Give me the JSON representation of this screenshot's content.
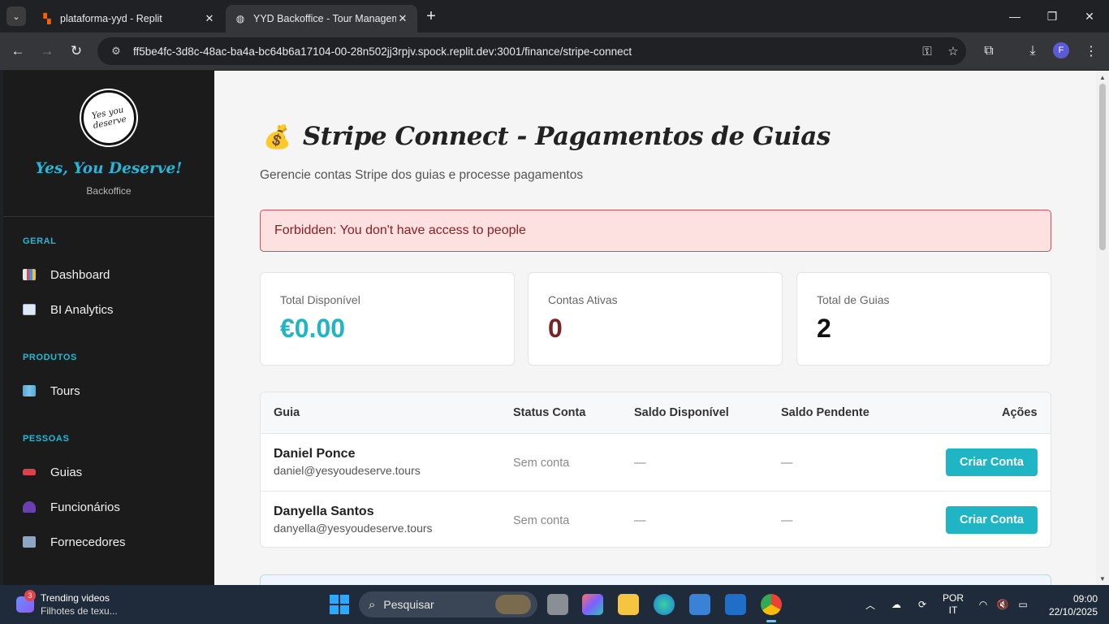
{
  "browser": {
    "tabs": [
      {
        "title": "plataforma-yyd - Replit",
        "active": false
      },
      {
        "title": "YYD Backoffice - Tour Management",
        "active": true
      }
    ],
    "url": "ff5be4fc-3d8c-48ac-ba4a-bc64b6a17104-00-28n502jj3rpjv.spock.replit.dev:3001/finance/stripe-connect",
    "profile_initial": "F"
  },
  "sidebar": {
    "logo_text": "Yes you deserve",
    "brand_name": "Yes, You Deserve!",
    "brand_sub": "Backoffice",
    "sections": [
      {
        "title": "GERAL",
        "items": [
          {
            "label": "Dashboard",
            "icon": "bar-chart-icon"
          },
          {
            "label": "BI Analytics",
            "icon": "line-chart-icon"
          }
        ]
      },
      {
        "title": "PRODUTOS",
        "items": [
          {
            "label": "Tours",
            "icon": "map-icon"
          }
        ]
      },
      {
        "title": "PESSOAS",
        "items": [
          {
            "label": "Guias",
            "icon": "car-icon"
          },
          {
            "label": "Funcionários",
            "icon": "person-icon"
          },
          {
            "label": "Fornecedores",
            "icon": "building-icon"
          }
        ]
      }
    ]
  },
  "page": {
    "title_emoji": "💰",
    "title": "Stripe Connect - Pagamentos de Guias",
    "subtitle": "Gerencie contas Stripe dos guias e processe pagamentos",
    "alert": "Forbidden: You don't have access to people",
    "stats": [
      {
        "label": "Total Disponível",
        "value": "€0.00",
        "color": "#1fb5c4"
      },
      {
        "label": "Contas Ativas",
        "value": "0",
        "color": "#7a2326"
      },
      {
        "label": "Total de Guias",
        "value": "2",
        "color": "#111111"
      }
    ],
    "table": {
      "headers": [
        "Guia",
        "Status Conta",
        "Saldo Disponível",
        "Saldo Pendente",
        "Ações"
      ],
      "rows": [
        {
          "name": "Daniel Ponce",
          "email": "daniel@yesyoudeserve.tours",
          "status": "Sem conta",
          "available": "—",
          "pending": "—",
          "action": "Criar Conta"
        },
        {
          "name": "Danyella Santos",
          "email": "danyella@yesyoudeserve.tours",
          "status": "Sem conta",
          "available": "—",
          "pending": "—",
          "action": "Criar Conta"
        }
      ]
    }
  },
  "taskbar": {
    "widget_badge": "3",
    "widget_title": "Trending videos",
    "widget_sub": "Filhotes de texu...",
    "search_placeholder": "Pesquisar",
    "lang_top": "POR",
    "lang_bottom": "IT",
    "time": "09:00",
    "date": "22/10/2025"
  },
  "colors": {
    "accent": "#1fb5c4",
    "brand": "#29b6d6",
    "alert_bg": "#fde1e1",
    "alert_border": "#d2505a"
  }
}
